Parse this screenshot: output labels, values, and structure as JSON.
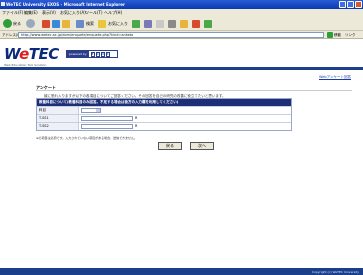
{
  "window": {
    "title": "WeTEC University EXOS - Microsoft Internet Explorer"
  },
  "menu": [
    "ファイル(F)",
    "編集(E)",
    "表示(V)",
    "お気に入り(A)",
    "ツール(T)",
    "ヘルプ(H)"
  ],
  "toolbar": {
    "back_label": "戻る",
    "search_label": "検索",
    "favorites_label": "お気に入り"
  },
  "address": {
    "label": "アドレス(D)",
    "url": "http://www.wetec.ac.jp/dom/enquete/enquete.php?kind=anketo",
    "go_label": "移動",
    "links_label": "リンク"
  },
  "header": {
    "logo_pre": "W",
    "logo_e": "e",
    "logo_post": "TEC",
    "powered_label": "powered by",
    "powered_letters": [
      "E",
      "X",
      "O",
      "S"
    ],
    "subtitle": "Web Education Tool Solution"
  },
  "page": {
    "privacy_link": "Webアンケート回答",
    "section_title": "アンケート",
    "intro": "誠に恐れ入りますが以下の各項目についてご回答ください。その回答を自己の研究の改善に役立てたいと思います。"
  },
  "form": {
    "header": "教養科目について(教養科目のみ回答。不足する場合は後方の入力欄を利用してください)",
    "rows": [
      {
        "label": "科目",
        "mark": ""
      },
      {
        "label": "T-SS1",
        "mark": "R"
      },
      {
        "label": "T-SS2",
        "mark": "R"
      }
    ]
  },
  "note": "※の項目は必須です。入力されていない項目がある場合、送信できません。",
  "buttons": {
    "back": "戻る",
    "next": "次へ"
  },
  "footer": {
    "copyright": "Copyright (c) WeTEC University"
  },
  "colors": {
    "brand_blue": "#1c3f8c",
    "logo_red": "#d81e1e",
    "table_head": "#1c2e78"
  }
}
